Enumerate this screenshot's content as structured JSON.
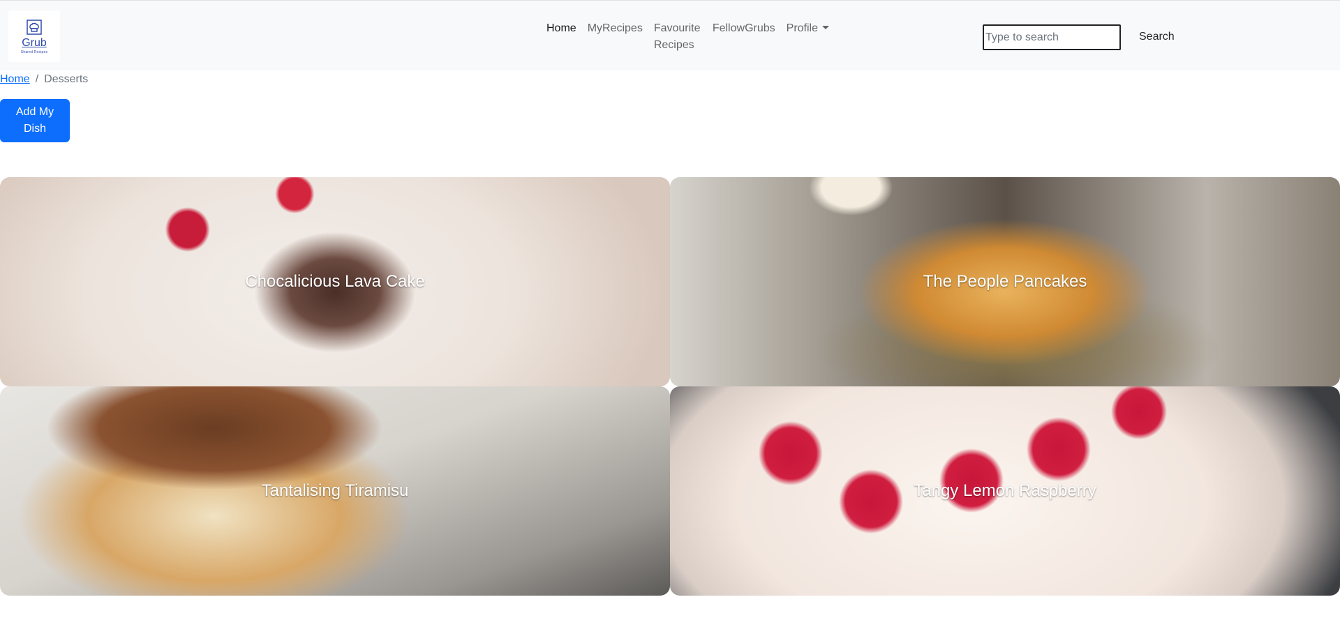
{
  "brand": {
    "title": "Grub",
    "subtitle": "Shared Recipes",
    "icon": "chef-hat-icon"
  },
  "nav": {
    "items": [
      {
        "label": "Home",
        "active": true
      },
      {
        "label": "MyRecipes",
        "active": false
      },
      {
        "label": "Favourite Recipes",
        "active": false
      },
      {
        "label": "FellowGrubs",
        "active": false
      },
      {
        "label": "Profile",
        "active": false,
        "dropdown": true
      }
    ]
  },
  "search": {
    "placeholder": "Type to search",
    "value": "",
    "button_label": "Search"
  },
  "breadcrumb": {
    "home": "Home",
    "separator": "/",
    "current": "Desserts"
  },
  "actions": {
    "add_dish_label": "Add My Dish"
  },
  "recipes": [
    {
      "title": "Chocalicious Lava Cake"
    },
    {
      "title": "The People Pancakes"
    },
    {
      "title": "Tantalising Tiramisu"
    },
    {
      "title": "Tangy Lemon Raspberry"
    }
  ],
  "colors": {
    "navbar_bg": "#f8f9fa",
    "primary": "#0d6efd",
    "link": "#0d6efd",
    "brand": "#2f4aa8"
  }
}
